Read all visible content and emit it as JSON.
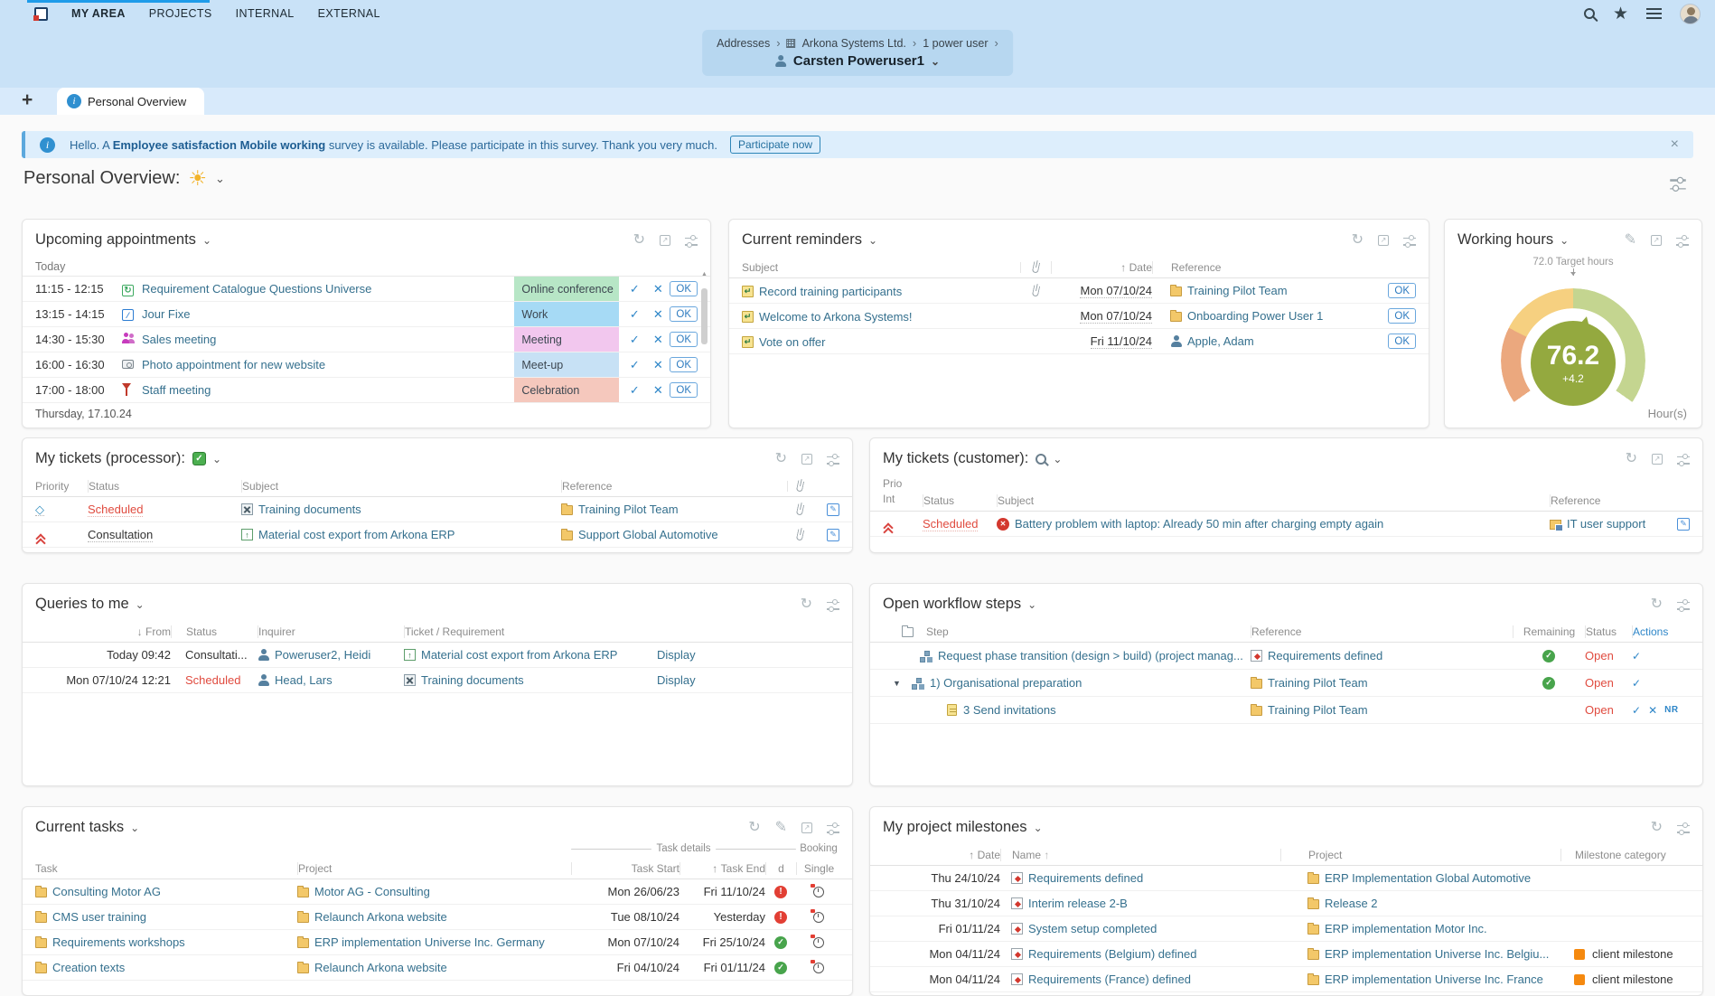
{
  "icons": {
    "refresh": "↻",
    "external": "↗",
    "pencil": "✎",
    "chevron": "⌄",
    "check": "✓",
    "cross": "✕",
    "up": "↑",
    "down": "↓",
    "sep": "›",
    "sun": "☀",
    "plus": "+",
    "close": "×",
    "expand": "▼",
    "scroll_up": "▲",
    "info": "i",
    "alert": "!",
    "diamond": "◇",
    "sync": "↻",
    "wrench": "⁄"
  },
  "topnav": {
    "items": [
      {
        "label": "MY AREA"
      },
      {
        "label": "PROJECTS"
      },
      {
        "label": "INTERNAL"
      },
      {
        "label": "EXTERNAL"
      }
    ]
  },
  "breadcrumb": {
    "items": [
      "Addresses",
      "Arkona Systems Ltd.",
      "1 power user"
    ],
    "user": "Carsten Poweruser1"
  },
  "tabs": {
    "active": "Personal Overview"
  },
  "banner": {
    "prefix": "Hello. A ",
    "bold": "Employee satisfaction Mobile working",
    "suffix": " survey is available. Please participate in this survey. Thank you very much.",
    "button": "Participate now"
  },
  "page": {
    "title": "Personal Overview:"
  },
  "labels": {
    "ok": "OK",
    "display": "Display",
    "nr": "NR"
  },
  "appointments": {
    "title": "Upcoming appointments",
    "group": "Today",
    "footer": "Thursday, 17.10.24",
    "rows": [
      {
        "time": "11:15 - 12:15",
        "title": "Requirement Catalogue Questions Universe",
        "badge": "Online conference",
        "badge_bg": "#b7e6c6"
      },
      {
        "time": "13:15 - 14:15",
        "title": "Jour Fixe",
        "badge": "Work",
        "badge_bg": "#a6daf5"
      },
      {
        "time": "14:30 - 15:30",
        "title": "Sales meeting",
        "badge": "Meeting",
        "badge_bg": "#f2c7ee"
      },
      {
        "time": "16:00 - 16:30",
        "title": "Photo appointment for new website",
        "badge": "Meet-up",
        "badge_bg": "#c7e1f5"
      },
      {
        "time": "17:00 - 18:00",
        "title": "Staff meeting",
        "badge": "Celebration",
        "badge_bg": "#f5c8bd"
      }
    ]
  },
  "reminders": {
    "title": "Current reminders",
    "cols": {
      "subject": "Subject",
      "date": "Date",
      "reference": "Reference"
    },
    "rows": [
      {
        "subject": "Record training participants",
        "date": "Mon 07/10/24",
        "reference": "Training Pilot Team"
      },
      {
        "subject": "Welcome to Arkona Systems!",
        "date": "Mon 07/10/24",
        "reference": "Onboarding Power User 1"
      },
      {
        "subject": "Vote on offer",
        "date": "Fri 11/10/24",
        "reference": "Apple, Adam"
      }
    ]
  },
  "hours": {
    "title": "Working hours",
    "target": "72.0 Target hours",
    "value": "76.2",
    "delta": "+4.2",
    "unit": "Hour(s)",
    "colors": {
      "low": "#eba87e",
      "mid": "#f6d080",
      "high": "#c4d590",
      "center": "#94a93f"
    }
  },
  "tickets_processor": {
    "title": "My tickets (processor):",
    "cols": {
      "priority": "Priority",
      "status": "Status",
      "subject": "Subject",
      "reference": "Reference"
    },
    "rows": [
      {
        "status": "Scheduled",
        "subject": "Training documents",
        "reference": "Training Pilot Team"
      },
      {
        "status": "Consultation",
        "subject": "Material cost export from Arkona ERP",
        "reference": "Support Global Automotive"
      }
    ]
  },
  "tickets_customer": {
    "title": "My tickets (customer):",
    "cols": {
      "prio_line1": "Prio",
      "prio_line2": "Int",
      "status": "Status",
      "subject": "Subject",
      "reference": "Reference"
    },
    "rows": [
      {
        "status": "Scheduled",
        "subject": "Battery problem with laptop: Already 50 min after charging empty again",
        "reference": "IT user support"
      }
    ]
  },
  "queries": {
    "title": "Queries to me",
    "cols": {
      "from": "From",
      "status": "Status",
      "inquirer": "Inquirer",
      "ticket": "Ticket / Requirement"
    },
    "rows": [
      {
        "from": "Today 09:42",
        "status": "Consultati...",
        "inquirer": "Poweruser2, Heidi",
        "ticket": "Material cost export from Arkona ERP"
      },
      {
        "from": "Mon 07/10/24 12:21",
        "status": "Scheduled",
        "inquirer": "Head, Lars",
        "ticket": "Training documents"
      }
    ]
  },
  "workflow": {
    "title": "Open workflow steps",
    "cols": {
      "step": "Step",
      "reference": "Reference",
      "remaining": "Remaining",
      "status": "Status",
      "actions": "Actions"
    },
    "rows": [
      {
        "step": "Request phase transition (design > build) (project manag...",
        "reference": "Requirements defined",
        "status": "Open"
      },
      {
        "step": "1) Organisational preparation",
        "reference": "Training Pilot Team",
        "status": "Open"
      },
      {
        "step": "3 Send invitations",
        "reference": "Training Pilot Team",
        "status": "Open"
      }
    ]
  },
  "tasks": {
    "title": "Current tasks",
    "groups": {
      "details": "Task details",
      "booking": "Booking"
    },
    "cols": {
      "task": "Task",
      "project": "Project",
      "start": "Task Start",
      "end": "Task End",
      "d": "d",
      "single": "Single"
    },
    "rows": [
      {
        "task": "Consulting Motor AG",
        "project": "Motor AG - Consulting",
        "start": "Mon 26/06/23",
        "end": "Fri 11/10/24"
      },
      {
        "task": "CMS user training",
        "project": "Relaunch Arkona website",
        "start": "Tue 08/10/24",
        "end": "Yesterday"
      },
      {
        "task": "Requirements workshops",
        "project": "ERP implementation Universe Inc. Germany",
        "start": "Mon 07/10/24",
        "end": "Fri 25/10/24"
      },
      {
        "task": "Creation texts",
        "project": "Relaunch Arkona website",
        "start": "Fri 04/10/24",
        "end": "Fri 01/11/24"
      }
    ]
  },
  "milestones": {
    "title": "My project milestones",
    "category_color": "#f5890f",
    "cols": {
      "date": "Date",
      "name": "Name",
      "project": "Project",
      "category": "Milestone category"
    },
    "rows": [
      {
        "date": "Thu 24/10/24",
        "name": "Requirements defined",
        "project": "ERP Implementation Global Automotive",
        "category": ""
      },
      {
        "date": "Thu 31/10/24",
        "name": "Interim release 2-B",
        "project": "Release 2",
        "category": ""
      },
      {
        "date": "Fri 01/11/24",
        "name": "System setup completed",
        "project": "ERP implementation Motor Inc.",
        "category": ""
      },
      {
        "date": "Mon 04/11/24",
        "name": "Requirements (Belgium) defined",
        "project": "ERP implementation Universe Inc. Belgiu...",
        "category": "client milestone"
      },
      {
        "date": "Mon 04/11/24",
        "name": "Requirements (France) defined",
        "project": "ERP implementation Universe Inc. France",
        "category": "client milestone"
      }
    ]
  }
}
